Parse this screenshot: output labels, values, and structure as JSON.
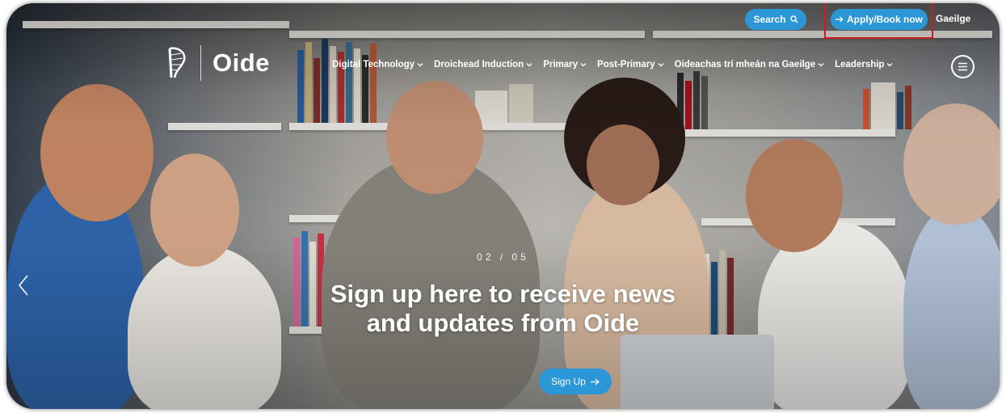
{
  "colors": {
    "accent": "#2b97d6",
    "highlight_border": "#d11b1b",
    "text_on_dark": "#ffffff"
  },
  "header": {
    "search": {
      "label": "Search",
      "icon": "search-icon"
    },
    "apply": {
      "label": "Apply/Book now",
      "icon": "arrow-right-icon"
    },
    "language": {
      "label": "Gaeilge"
    }
  },
  "logo": {
    "text": "Oide",
    "icon": "harp-icon"
  },
  "nav": {
    "items": [
      {
        "label": "Digital Technology"
      },
      {
        "label": "Droichead Induction"
      },
      {
        "label": "Primary"
      },
      {
        "label": "Post-Primary"
      },
      {
        "label": "Oideachas trí mheán na Gaeilge"
      },
      {
        "label": "Leadership"
      }
    ],
    "menu_icon": "hamburger-menu-icon",
    "dropdown_icon": "chevron-down-icon"
  },
  "slider": {
    "counter": "02 / 05",
    "headline_line1": "Sign up here to receive news",
    "headline_line2": "and updates from Oide",
    "cta": {
      "label": "Sign Up",
      "icon": "arrow-right-icon"
    },
    "prev_icon": "chevron-left-icon"
  }
}
